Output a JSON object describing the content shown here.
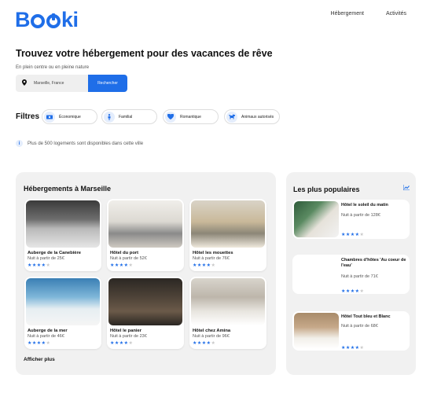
{
  "brand": {
    "logo": "Booki",
    "accent": "#1f6ee8"
  },
  "nav": {
    "items": [
      "Hébergement",
      "Activités"
    ]
  },
  "hero": {
    "title": "Trouvez votre hébergement pour des vacances de rêve",
    "subtitle": "En plein centre ou en pleine nature",
    "search_value": "Marseille, France",
    "search_button": "Rechercher"
  },
  "filters": {
    "label": "Filtres",
    "chips": [
      {
        "label": "Économique",
        "icon": "money-icon"
      },
      {
        "label": "Familial",
        "icon": "child-icon"
      },
      {
        "label": "Romantique",
        "icon": "heart-icon"
      },
      {
        "label": "Animaux autorisés",
        "icon": "dog-icon"
      }
    ]
  },
  "info": {
    "text": "Plus de 500 logements sont disponibles dans cette ville"
  },
  "hebergements": {
    "title": "Hébergements à Marseille",
    "more": "Afficher plus",
    "cards": [
      {
        "name": "Auberge de la Canebière",
        "price": "Nuit à partir de 25€",
        "rating": 4
      },
      {
        "name": "Hôtel du port",
        "price": "Nuit à partir de 52€",
        "rating": 4
      },
      {
        "name": "Hôtel les mouettes",
        "price": "Nuit à partir de 76€",
        "rating": 4
      },
      {
        "name": "Auberge de la mer",
        "price": "Nuit à partir de 46€",
        "rating": 4
      },
      {
        "name": "Hôtel le panier",
        "price": "Nuit à partir de 23€",
        "rating": 4
      },
      {
        "name": "Hôtel chez Amina",
        "price": "Nuit à partir de 96€",
        "rating": 4
      }
    ]
  },
  "populaires": {
    "title": "Les plus populaires",
    "cards": [
      {
        "name": "Hôtel le soleil du matin",
        "price": "Nuit à partir de 128€",
        "rating": 4
      },
      {
        "name": "Chambres d'hôtes 'Au coeur de l'eau'",
        "price": "Nuit à partir de 71€",
        "rating": 4
      },
      {
        "name": "Hôtel Tout bleu et Blanc",
        "price": "Nuit à partir de 68€",
        "rating": 4
      }
    ]
  }
}
